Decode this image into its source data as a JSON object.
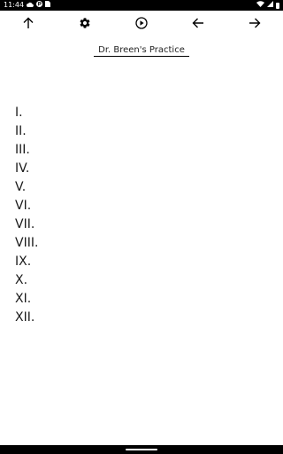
{
  "status_bar": {
    "time": "11:44",
    "icons": [
      "cloud-icon",
      "p-badge-icon",
      "sim-card-icon",
      "wifi-icon",
      "signal-icon",
      "battery-icon"
    ]
  },
  "toolbar": {
    "buttons": [
      "arrow-up-icon",
      "gear-icon",
      "play-circle-icon",
      "arrow-left-icon",
      "arrow-right-icon"
    ]
  },
  "document": {
    "title": "Dr. Breen's Practice"
  },
  "numerals": [
    "I.",
    "II.",
    "III.",
    "IV.",
    "V.",
    "VI.",
    "VII.",
    "VIII.",
    "IX.",
    "X.",
    "XI.",
    "XII."
  ],
  "colors": {
    "background": "#ffffff",
    "system_bars": "#000000",
    "text": "#1a1a1a"
  }
}
